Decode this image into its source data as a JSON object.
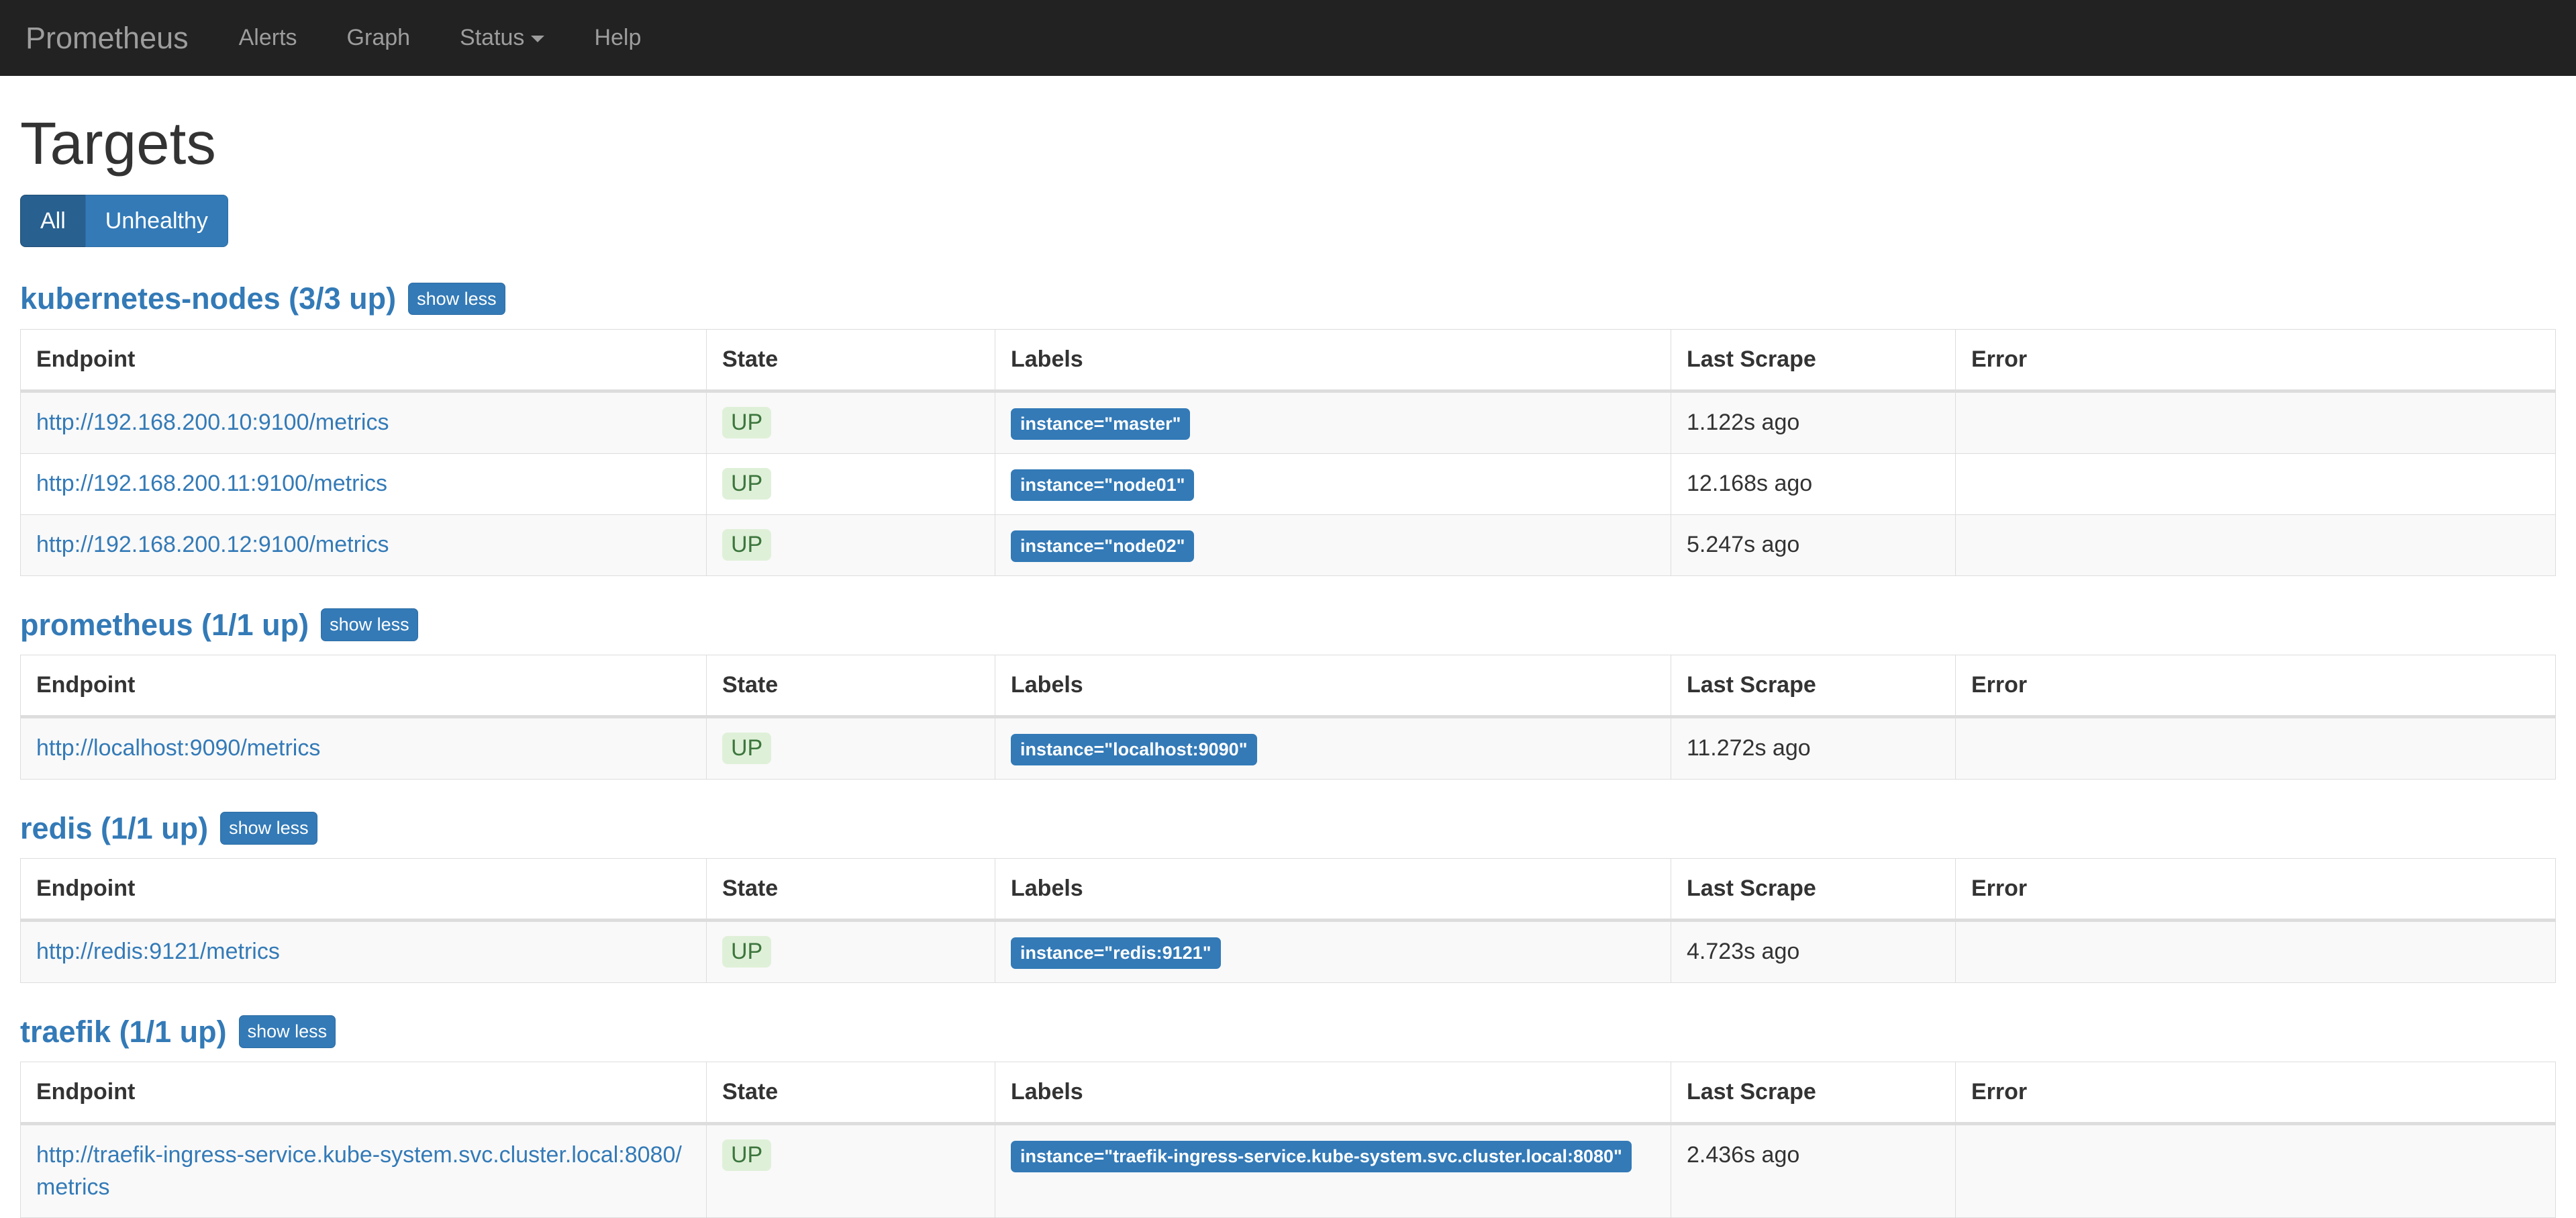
{
  "navbar": {
    "brand": "Prometheus",
    "items": [
      {
        "label": "Alerts",
        "has_caret": false
      },
      {
        "label": "Graph",
        "has_caret": false
      },
      {
        "label": "Status",
        "has_caret": true
      },
      {
        "label": "Help",
        "has_caret": false
      }
    ]
  },
  "page": {
    "title": "Targets"
  },
  "filters": {
    "all_label": "All",
    "unhealthy_label": "Unhealthy",
    "active": "All"
  },
  "table_headers": {
    "endpoint": "Endpoint",
    "state": "State",
    "labels": "Labels",
    "last_scrape": "Last Scrape",
    "error": "Error"
  },
  "colors": {
    "navbar_bg": "#222222",
    "link_blue": "#337ab7",
    "active_button": "#286090",
    "up_badge_bg": "#dff0d8",
    "up_badge_text": "#3c763d",
    "label_badge_bg": "#337ab7"
  },
  "jobs": [
    {
      "name": "kubernetes-nodes",
      "heading": "kubernetes-nodes (3/3 up)",
      "toggle_label": "show less",
      "targets": [
        {
          "endpoint": "http://192.168.200.10:9100/metrics",
          "state": "UP",
          "labels": [
            "instance=\"master\""
          ],
          "last_scrape": "1.122s ago",
          "error": ""
        },
        {
          "endpoint": "http://192.168.200.11:9100/metrics",
          "state": "UP",
          "labels": [
            "instance=\"node01\""
          ],
          "last_scrape": "12.168s ago",
          "error": ""
        },
        {
          "endpoint": "http://192.168.200.12:9100/metrics",
          "state": "UP",
          "labels": [
            "instance=\"node02\""
          ],
          "last_scrape": "5.247s ago",
          "error": ""
        }
      ]
    },
    {
      "name": "prometheus",
      "heading": "prometheus (1/1 up)",
      "toggle_label": "show less",
      "targets": [
        {
          "endpoint": "http://localhost:9090/metrics",
          "state": "UP",
          "labels": [
            "instance=\"localhost:9090\""
          ],
          "last_scrape": "11.272s ago",
          "error": ""
        }
      ]
    },
    {
      "name": "redis",
      "heading": "redis (1/1 up)",
      "toggle_label": "show less",
      "targets": [
        {
          "endpoint": "http://redis:9121/metrics",
          "state": "UP",
          "labels": [
            "instance=\"redis:9121\""
          ],
          "last_scrape": "4.723s ago",
          "error": ""
        }
      ]
    },
    {
      "name": "traefik",
      "heading": "traefik (1/1 up)",
      "toggle_label": "show less",
      "targets": [
        {
          "endpoint": "http://traefik-ingress-service.kube-system.svc.cluster.local:8080/metrics",
          "state": "UP",
          "labels": [
            "instance=\"traefik-ingress-service.kube-system.svc.cluster.local:8080\""
          ],
          "last_scrape": "2.436s ago",
          "error": ""
        }
      ]
    }
  ]
}
